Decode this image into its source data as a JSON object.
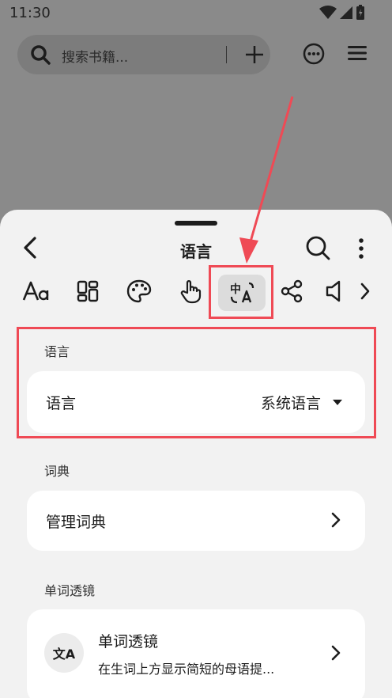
{
  "status": {
    "time": "11:30"
  },
  "topbar": {
    "search_placeholder": "搜索书籍..."
  },
  "sheet": {
    "title": "语言",
    "tabs": [
      {
        "icon": "font-size-icon"
      },
      {
        "icon": "layout-grid-icon"
      },
      {
        "icon": "palette-icon"
      },
      {
        "icon": "touch-gesture-icon"
      },
      {
        "icon": "translate-icon",
        "active": true
      },
      {
        "icon": "share-icon"
      },
      {
        "icon": "speaker-icon"
      }
    ],
    "sections": {
      "language": {
        "label": "语言",
        "row_label": "语言",
        "row_value": "系统语言"
      },
      "dictionary": {
        "label": "词典",
        "row_label": "管理词典"
      },
      "word_lens": {
        "label": "单词透镜",
        "row_title": "单词透镜",
        "row_subtitle": "在生词上方显示简短的母语提...",
        "avatar_text": "文A"
      }
    }
  },
  "colors": {
    "accent_annotation": "#ef4a55",
    "scrim": "#8a8a8a",
    "sheet_bg": "#f2f2f2"
  }
}
